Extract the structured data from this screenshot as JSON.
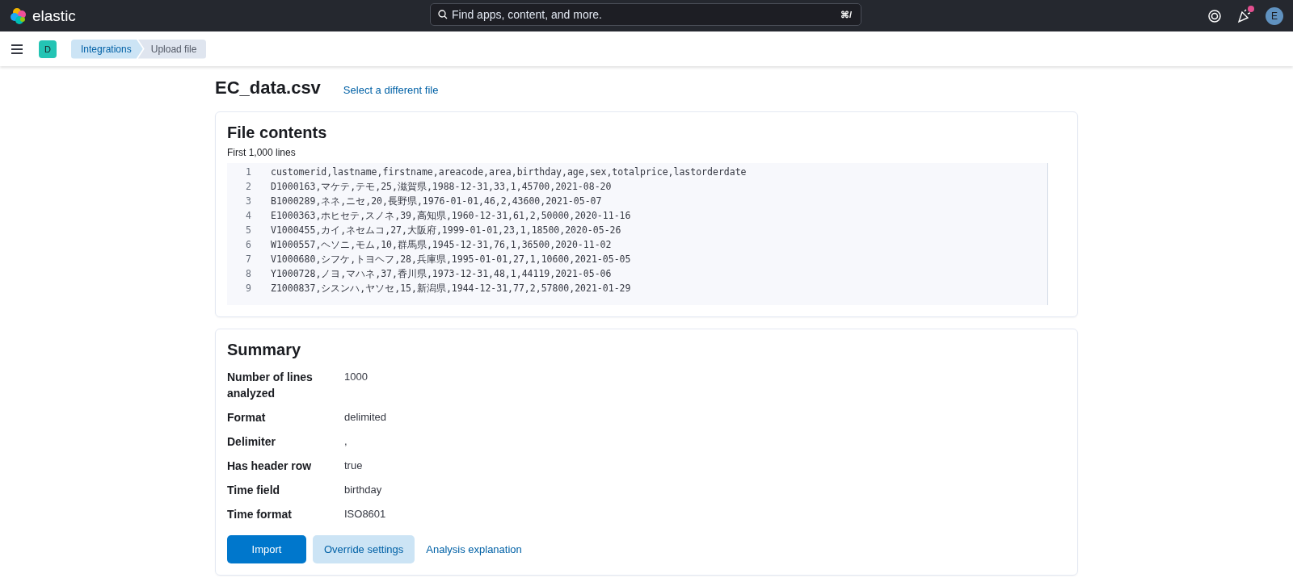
{
  "header": {
    "brand": "elastic",
    "search": {
      "placeholder": "Find apps, content, and more.",
      "shortcut": "⌘/"
    },
    "avatar": "E",
    "news_unread": true
  },
  "nav": {
    "space": "D",
    "breadcrumbs": [
      {
        "label": "Integrations",
        "selected": false
      },
      {
        "label": "Upload file",
        "selected": true
      }
    ]
  },
  "page": {
    "title": "EC_data.csv",
    "link": "Select a different file"
  },
  "file_contents": {
    "title": "File contents",
    "subtitle": "First 1,000 lines",
    "lines": [
      {
        "number": "1",
        "text": "customerid,lastname,firstname,areacode,area,birthday,age,sex,totalprice,lastorderdate"
      },
      {
        "number": "2",
        "text": "D1000163,マケテ,テモ,25,滋賀県,1988-12-31,33,1,45700,2021-08-20"
      },
      {
        "number": "3",
        "text": "B1000289,ネネ,ニセ,20,長野県,1976-01-01,46,2,43600,2021-05-07"
      },
      {
        "number": "4",
        "text": "E1000363,ホヒセテ,スノネ,39,高知県,1960-12-31,61,2,50000,2020-11-16"
      },
      {
        "number": "5",
        "text": "V1000455,カイ,ネセムコ,27,大阪府,1999-01-01,23,1,18500,2020-05-26"
      },
      {
        "number": "6",
        "text": "W1000557,ヘソニ,モム,10,群馬県,1945-12-31,76,1,36500,2020-11-02"
      },
      {
        "number": "7",
        "text": "V1000680,シフケ,トヨヘフ,28,兵庫県,1995-01-01,27,1,10600,2021-05-05"
      },
      {
        "number": "8",
        "text": "Y1000728,ノヨ,マハネ,37,香川県,1973-12-31,48,1,44119,2021-05-06"
      },
      {
        "number": "9",
        "text": "Z1000837,シスンハ,ヤソセ,15,新潟県,1944-12-31,77,2,57800,2021-01-29"
      }
    ]
  },
  "summary": {
    "title": "Summary",
    "rows": [
      {
        "label": "Number of lines analyzed",
        "value": "1000"
      },
      {
        "label": "Format",
        "value": "delimited"
      },
      {
        "label": "Delimiter",
        "value": ","
      },
      {
        "label": "Has header row",
        "value": "true"
      },
      {
        "label": "Time field",
        "value": "birthday"
      },
      {
        "label": "Time format",
        "value": "ISO8601"
      }
    ],
    "actions": [
      {
        "label": "Import",
        "kind": "primary"
      },
      {
        "label": "Override settings",
        "kind": "secondary"
      },
      {
        "label": "Analysis explanation",
        "kind": "link"
      }
    ]
  }
}
